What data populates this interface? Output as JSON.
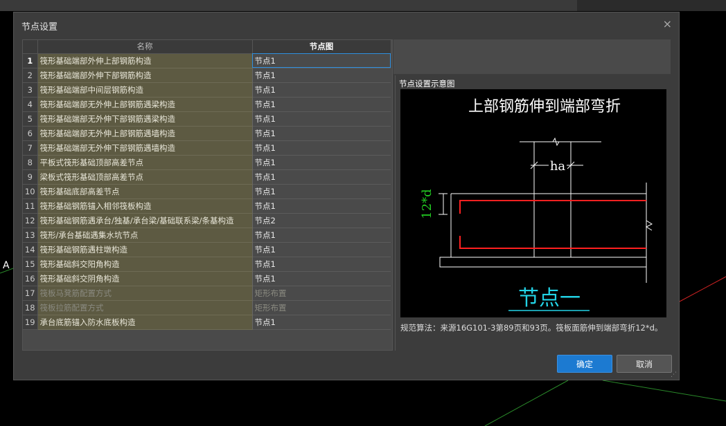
{
  "background": {
    "axis_label": "A"
  },
  "dialog": {
    "title": "节点设置",
    "close_icon": "×"
  },
  "table": {
    "headers": {
      "name": "名称",
      "image": "节点图"
    },
    "rows": [
      {
        "idx": "1",
        "name": "筏形基础端部外伸上部钢筋构造",
        "value": "节点1",
        "disabled": false
      },
      {
        "idx": "2",
        "name": "筏形基础端部外伸下部钢筋构造",
        "value": "节点1",
        "disabled": false
      },
      {
        "idx": "3",
        "name": "筏形基础端部中间层钢筋构造",
        "value": "节点1",
        "disabled": false
      },
      {
        "idx": "4",
        "name": "筏形基础端部无外伸上部钢筋遇梁构造",
        "value": "节点1",
        "disabled": false
      },
      {
        "idx": "5",
        "name": "筏形基础端部无外伸下部钢筋遇梁构造",
        "value": "节点1",
        "disabled": false
      },
      {
        "idx": "6",
        "name": "筏形基础端部无外伸上部钢筋遇墙构造",
        "value": "节点1",
        "disabled": false
      },
      {
        "idx": "7",
        "name": "筏形基础端部无外伸下部钢筋遇墙构造",
        "value": "节点1",
        "disabled": false
      },
      {
        "idx": "8",
        "name": "平板式筏形基础顶部高差节点",
        "value": "节点1",
        "disabled": false
      },
      {
        "idx": "9",
        "name": "梁板式筏形基础顶部高差节点",
        "value": "节点1",
        "disabled": false
      },
      {
        "idx": "10",
        "name": "筏形基础底部高差节点",
        "value": "节点1",
        "disabled": false
      },
      {
        "idx": "11",
        "name": "筏形基础钢筋锚入相邻筏板构造",
        "value": "节点1",
        "disabled": false
      },
      {
        "idx": "12",
        "name": "筏形基础钢筋遇承台/独基/承台梁/基础联系梁/条基构造",
        "value": "节点2",
        "disabled": false
      },
      {
        "idx": "13",
        "name": "筏形/承台基础遇集水坑节点",
        "value": "节点1",
        "disabled": false
      },
      {
        "idx": "14",
        "name": "筏形基础钢筋遇柱墩构造",
        "value": "节点1",
        "disabled": false
      },
      {
        "idx": "15",
        "name": "筏形基础斜交阳角构造",
        "value": "节点1",
        "disabled": false
      },
      {
        "idx": "16",
        "name": "筏形基础斜交阴角构造",
        "value": "节点1",
        "disabled": false
      },
      {
        "idx": "17",
        "name": "筏板马凳筋配置方式",
        "value": "矩形布置",
        "disabled": true
      },
      {
        "idx": "18",
        "name": "筏板拉筋配置方式",
        "value": "矩形布置",
        "disabled": true
      },
      {
        "idx": "19",
        "name": "承台底筋锚入防水底板构造",
        "value": "节点1",
        "disabled": false
      }
    ]
  },
  "preview": {
    "label": "节点设置示意图",
    "diagram_title": "上部钢筋伸到端部弯折",
    "dim_ha": "ha",
    "dim_12d": "12*d",
    "node_name": "节点一",
    "colors": {
      "rebar": "#ff2020",
      "dim_text": "#22cc22",
      "node_name": "#22d3e6",
      "lines": "#ffffff"
    },
    "description": "规范算法：来源16G101-3第89页和93页。筏板面筋伸到端部弯折12*d。"
  },
  "buttons": {
    "ok": "确定",
    "cancel": "取消"
  }
}
